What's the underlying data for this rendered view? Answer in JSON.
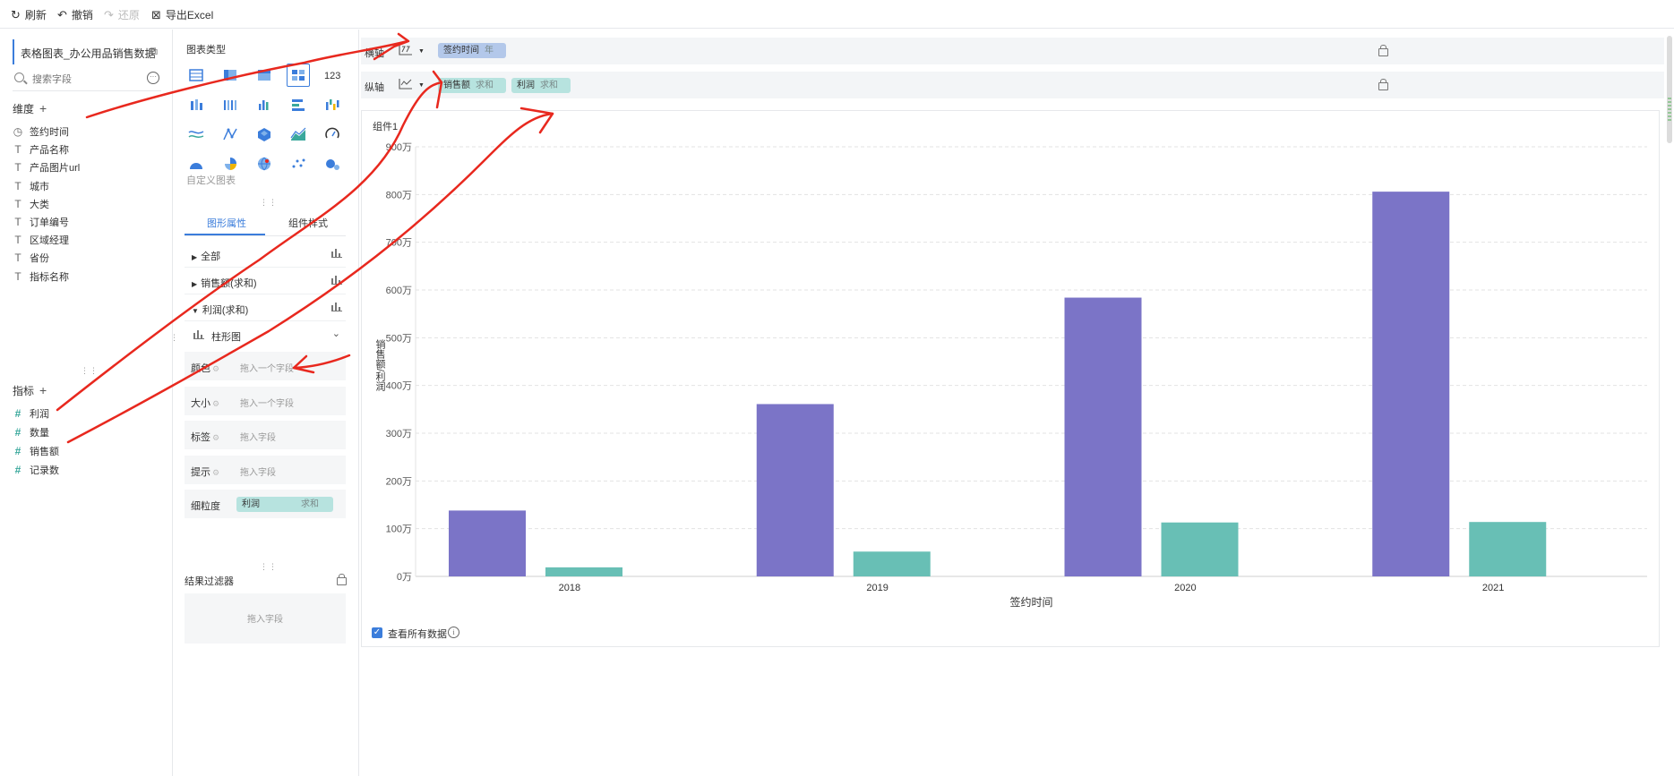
{
  "toolbar": {
    "refresh": "刷新",
    "undo": "撤销",
    "redo": "还原",
    "export": "导出Excel"
  },
  "left": {
    "dataset": "表格图表_办公用品销售数据",
    "search_placeholder": "搜索字段",
    "dimensions_title": "维度",
    "dimensions": [
      {
        "icon": "clock-icon",
        "label": "签约时间"
      },
      {
        "icon": "text-type-icon",
        "label": "产品名称"
      },
      {
        "icon": "text-type-icon",
        "label": "产品图片url"
      },
      {
        "icon": "text-type-icon",
        "label": "城市"
      },
      {
        "icon": "text-type-icon",
        "label": "大类"
      },
      {
        "icon": "text-type-icon",
        "label": "订单编号"
      },
      {
        "icon": "text-type-icon",
        "label": "区域经理"
      },
      {
        "icon": "text-type-icon",
        "label": "省份"
      },
      {
        "icon": "text-type-icon",
        "label": "指标名称"
      }
    ],
    "measures_title": "指标",
    "measures": [
      {
        "icon": "hash-icon",
        "label": "利润"
      },
      {
        "icon": "hash-icon",
        "label": "数量"
      },
      {
        "icon": "hash-icon",
        "label": "销售额"
      },
      {
        "icon": "hash-icon",
        "label": "记录数"
      }
    ]
  },
  "middle": {
    "chart_type_title": "图表类型",
    "custom_chart": "自定义图表",
    "tabs": [
      "图形属性",
      "组件样式"
    ],
    "props": [
      {
        "label": "全部"
      },
      {
        "label": "销售额(求和)"
      },
      {
        "label": "利润(求和)"
      }
    ],
    "bar_label": "柱形图",
    "drops": [
      {
        "label": "颜色",
        "placeholder": "拖入一个字段"
      },
      {
        "label": "大小",
        "placeholder": "拖入一个字段"
      },
      {
        "label": "标签",
        "placeholder": "拖入字段"
      },
      {
        "label": "提示",
        "placeholder": "拖入字段"
      }
    ],
    "granularity_label": "细粒度",
    "granularity_field": "利润",
    "granularity_agg": "求和",
    "filter_title": "结果过滤器",
    "filter_placeholder": "拖入字段"
  },
  "axes": {
    "x_label": "横轴",
    "x_field": "签约时间",
    "x_field_sub": "年",
    "y_label": "纵轴",
    "y_fields": [
      {
        "name": "销售额",
        "agg": "求和"
      },
      {
        "name": "利润",
        "agg": "求和"
      }
    ]
  },
  "component": {
    "name": "组件1",
    "view_all": "查看所有数据",
    "info": "i"
  },
  "colors": {
    "accent": "#3b7ddb",
    "sales": "#7b74c7",
    "profit": "#68bfb5",
    "annotation": "#e8281e"
  },
  "chart_data": {
    "type": "bar",
    "categories": [
      "2018",
      "2019",
      "2020",
      "2021"
    ],
    "series": [
      {
        "values": [
          1380000,
          3610000,
          5840000,
          8060000
        ]
      },
      {
        "values": [
          190000,
          520000,
          1130000,
          1140000
        ]
      }
    ],
    "xlabel": "签约时间",
    "ylabel": "销售额/利润",
    "ylim": [
      0,
      9000000
    ],
    "yticks": [
      "0万",
      "100万",
      "200万",
      "300万",
      "400万",
      "500万",
      "600万",
      "700万",
      "800万",
      "900万"
    ],
    "grid": true
  }
}
